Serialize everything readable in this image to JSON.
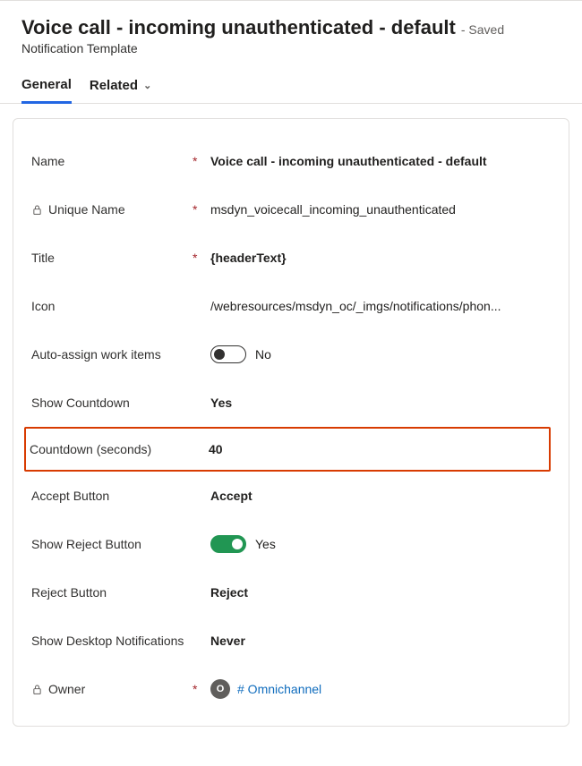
{
  "header": {
    "title": "Voice call - incoming unauthenticated - default",
    "status_suffix": "- Saved",
    "entity": "Notification Template"
  },
  "tabs": {
    "general": "General",
    "related": "Related"
  },
  "fields": {
    "name": {
      "label": "Name",
      "value": "Voice call - incoming unauthenticated - default"
    },
    "unique_name": {
      "label": "Unique Name",
      "value": "msdyn_voicecall_incoming_unauthenticated"
    },
    "title": {
      "label": "Title",
      "value": "{headerText}"
    },
    "icon": {
      "label": "Icon",
      "value": "/webresources/msdyn_oc/_imgs/notifications/phon..."
    },
    "auto_assign": {
      "label": "Auto-assign work items",
      "value_text": "No"
    },
    "show_countdown": {
      "label": "Show Countdown",
      "value": "Yes"
    },
    "countdown_seconds": {
      "label": "Countdown (seconds)",
      "value": "40"
    },
    "accept_button": {
      "label": "Accept Button",
      "value": "Accept"
    },
    "show_reject": {
      "label": "Show Reject Button",
      "value_text": "Yes"
    },
    "reject_button": {
      "label": "Reject Button",
      "value": "Reject"
    },
    "show_desktop": {
      "label": "Show Desktop Notifications",
      "value": "Never"
    },
    "owner": {
      "label": "Owner",
      "avatar_initial": "O",
      "link_text": "# Omnichannel"
    }
  }
}
